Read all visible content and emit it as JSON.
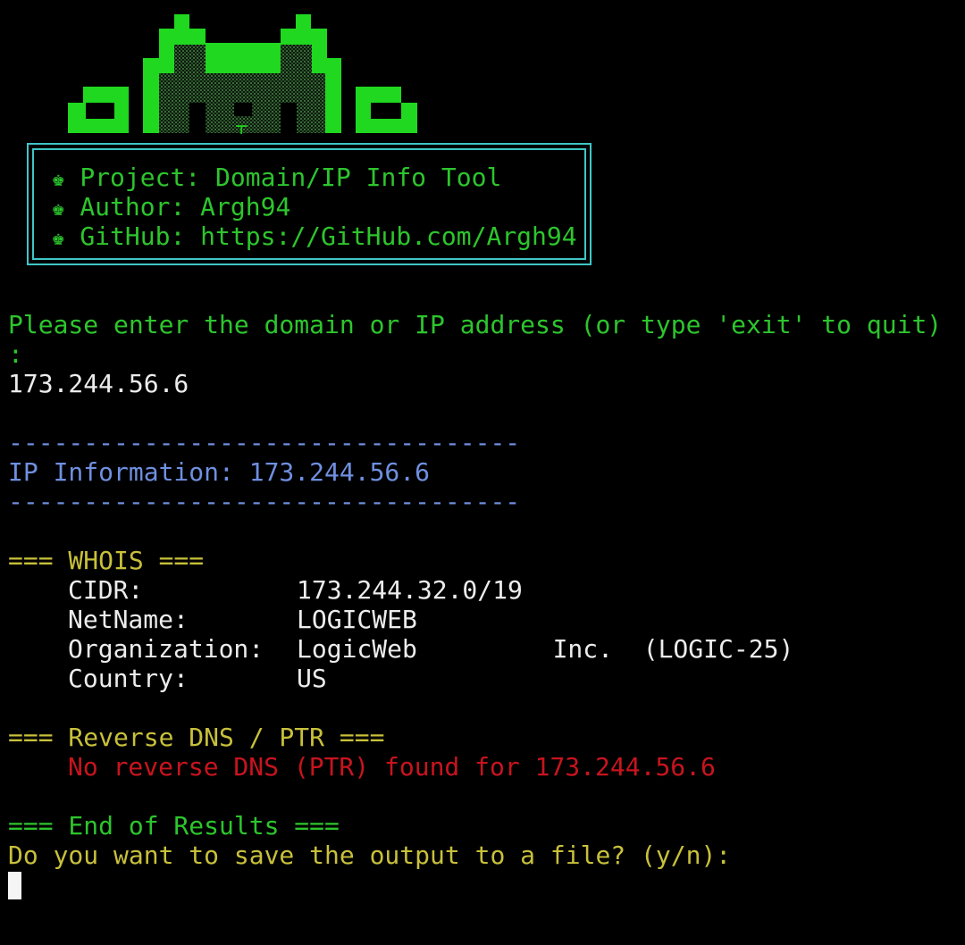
{
  "banner": {
    "bullet_icon": "crown-icon",
    "project": "Project: Domain/IP Info Tool",
    "author": "Author: Argh94",
    "github": "GitHub: https://GitHub.com/Argh94"
  },
  "prompt": {
    "line1": "Please enter the domain or IP address (or type 'exit' to quit)",
    "line2": ":",
    "input_value": "173.244.56.6"
  },
  "ip_section": {
    "rule": "----------------------------------",
    "label": "IP Information: 173.244.56.6"
  },
  "whois": {
    "header": "=== WHOIS ===",
    "rows": [
      {
        "key": "CIDR:",
        "value": "173.244.32.0/19"
      },
      {
        "key": "NetName:",
        "value": "LOGICWEB"
      },
      {
        "key": "Organization:",
        "value": "LogicWeb         Inc.  (LOGIC-25)"
      },
      {
        "key": "Country:",
        "value": "US"
      }
    ]
  },
  "reverse_dns": {
    "header": "=== Reverse DNS / PTR ===",
    "message": "No reverse DNS (PTR) found for 173.244.56.6"
  },
  "footer": {
    "end": "=== End of Results ===",
    "save_prompt": "Do you want to save the output to a file? (y/n):"
  },
  "colors": {
    "background": "#000000",
    "green": "#2dc52d",
    "blue": "#6f8fe0",
    "yellow": "#c8c03a",
    "red": "#c8141e",
    "box_border": "#3fc6c6"
  }
}
